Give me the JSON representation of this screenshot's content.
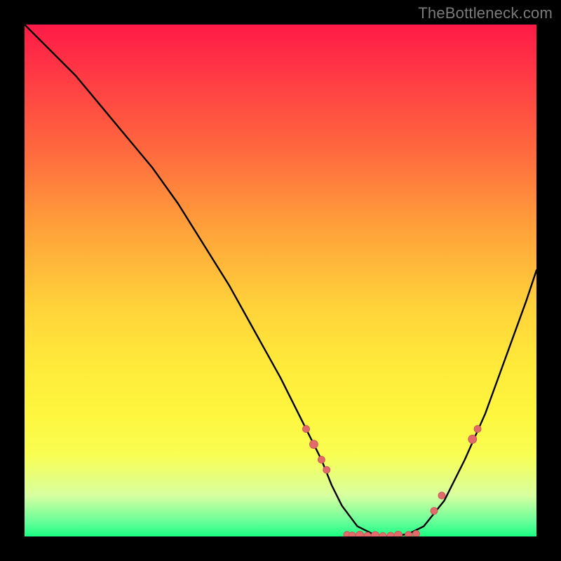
{
  "watermark": "TheBottleneck.com",
  "colors": {
    "frame": "#000000",
    "curve_stroke": "#000000",
    "marker_fill": "#e26a6a",
    "marker_stroke": "#c45555"
  },
  "chart_data": {
    "type": "line",
    "title": "",
    "xlabel": "",
    "ylabel": "",
    "xlim": [
      0,
      100
    ],
    "ylim": [
      0,
      100
    ],
    "grid": false,
    "legend": false,
    "series": [
      {
        "name": "curve",
        "x": [
          0,
          5,
          10,
          15,
          20,
          25,
          30,
          35,
          40,
          45,
          50,
          55,
          58,
          60,
          62,
          65,
          68,
          70,
          72,
          75,
          78,
          82,
          86,
          90,
          94,
          98,
          100
        ],
        "y": [
          100,
          95,
          90,
          84,
          78,
          72,
          65,
          57,
          49,
          40,
          31,
          21,
          15,
          10,
          6,
          2,
          0.5,
          0,
          0,
          0.5,
          2,
          7,
          15,
          24,
          35,
          46,
          52
        ]
      }
    ],
    "markers": [
      {
        "x": 55,
        "y": 21,
        "size": 5
      },
      {
        "x": 56.5,
        "y": 18,
        "size": 6
      },
      {
        "x": 58,
        "y": 15,
        "size": 5
      },
      {
        "x": 59,
        "y": 13,
        "size": 5
      },
      {
        "x": 63,
        "y": 0.3,
        "size": 5
      },
      {
        "x": 64,
        "y": 0.2,
        "size": 5
      },
      {
        "x": 65.5,
        "y": 0.2,
        "size": 6
      },
      {
        "x": 67,
        "y": 0.15,
        "size": 5
      },
      {
        "x": 68.5,
        "y": 0.15,
        "size": 6
      },
      {
        "x": 70,
        "y": 0.1,
        "size": 5
      },
      {
        "x": 71.5,
        "y": 0.15,
        "size": 5
      },
      {
        "x": 73,
        "y": 0.2,
        "size": 6
      },
      {
        "x": 75,
        "y": 0.3,
        "size": 5
      },
      {
        "x": 76.5,
        "y": 0.5,
        "size": 5
      },
      {
        "x": 80,
        "y": 5,
        "size": 5
      },
      {
        "x": 81.5,
        "y": 8,
        "size": 5
      },
      {
        "x": 87.5,
        "y": 19,
        "size": 6
      },
      {
        "x": 88.5,
        "y": 21,
        "size": 5
      }
    ]
  }
}
